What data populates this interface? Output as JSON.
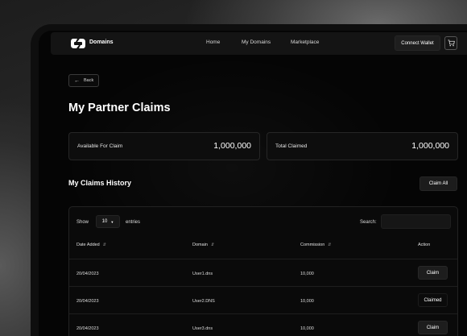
{
  "nav": {
    "brand": "Domains",
    "links": [
      "Home",
      "My Domains",
      "Marketplace"
    ],
    "connect_label": "Connect Wallet"
  },
  "page": {
    "back_label": "Back",
    "title": "My Partner Claims"
  },
  "stats": [
    {
      "label": "Available For Claim",
      "value": "1,000,000"
    },
    {
      "label": "Total Claimed",
      "value": "1,000,000"
    }
  ],
  "history": {
    "title": "My Claims History",
    "claim_all_label": "Claim All",
    "show_label": "Show",
    "show_value": "10",
    "entries_label": "entries",
    "search_label": "Search:",
    "search_value": "",
    "columns": [
      "Date Added",
      "Domain",
      "Commission",
      "Action"
    ],
    "rows": [
      {
        "date": "20/04/2023",
        "domain": "User1.dns",
        "commission": "10,000",
        "action": "Claim"
      },
      {
        "date": "20/04/2023",
        "domain": "User2.DNS",
        "commission": "10,000",
        "action": "Claimed"
      },
      {
        "date": "20/04/2023",
        "domain": "User3.dns",
        "commission": "10,000",
        "action": "Claim"
      }
    ]
  },
  "icons": [
    "logo-icon",
    "cart-icon",
    "arrow-left-icon",
    "chevron-down-icon",
    "sort-icon"
  ],
  "colors": {
    "background": "#050505",
    "panel": "#0d0d0d",
    "button": "#1d1d1d",
    "text": "#ffffff"
  }
}
